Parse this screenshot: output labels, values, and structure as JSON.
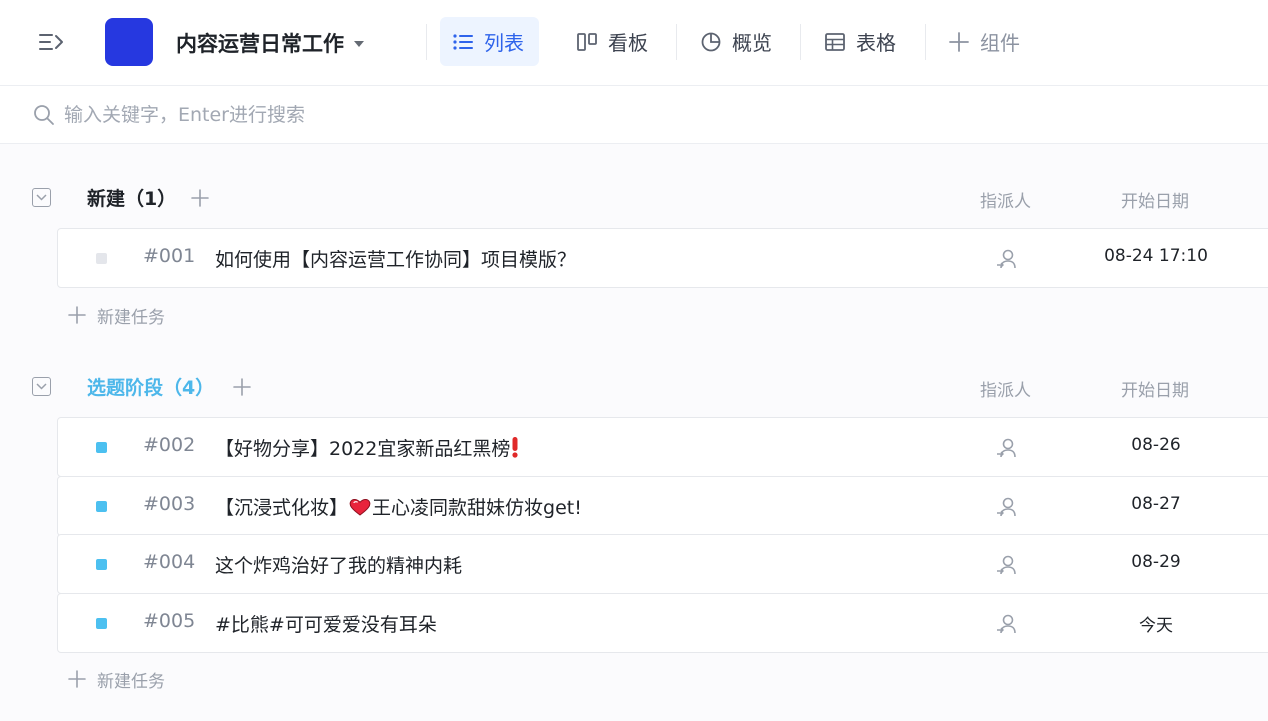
{
  "header": {
    "project_name": "内容运营日常工作",
    "project_color": "#2638e0",
    "accent_color": "#2e63eb",
    "tabs": [
      {
        "label": "列表",
        "icon": "list-icon",
        "active": true
      },
      {
        "label": "看板",
        "icon": "kanban-icon",
        "active": false
      },
      {
        "label": "概览",
        "icon": "pie-chart-icon",
        "active": false
      },
      {
        "label": "表格",
        "icon": "table-icon",
        "active": false
      },
      {
        "label": "组件",
        "icon": "plus-icon",
        "active": false
      }
    ]
  },
  "search": {
    "placeholder": "输入关键字，Enter进行搜索",
    "value": ""
  },
  "columns": {
    "assignee": "指派人",
    "start_date": "开始日期"
  },
  "groups": [
    {
      "title": "新建（1）",
      "title_color": "#1f2329",
      "status_color": "#e4e6eb",
      "new_task_label": "新建任务",
      "tasks": [
        {
          "id": "#001",
          "title": "如何使用【内容运营工作协同】项目模版？",
          "date": "08-24 17:10"
        }
      ]
    },
    {
      "title": "选题阶段（4）",
      "title_color": "#4db7ea",
      "status_color": "#4cc0f0",
      "new_task_label": "新建任务",
      "tasks": [
        {
          "id": "#002",
          "title_before": "【好物分享】2022宜家新品红黑榜",
          "emoji": "exclamation-emoji",
          "title_after": "",
          "date": "08-26"
        },
        {
          "id": "#003",
          "title_before": "【沉浸式化妆】",
          "emoji": "heart-emoji",
          "title_after": "王心凌同款甜妹仿妆get!",
          "date": "08-27"
        },
        {
          "id": "#004",
          "title_before": "这个炸鸡治好了我的精神内耗",
          "date": "08-29"
        },
        {
          "id": "#005",
          "title_before": "#比熊#可可爱爱没有耳朵",
          "date": "今天"
        }
      ]
    }
  ]
}
